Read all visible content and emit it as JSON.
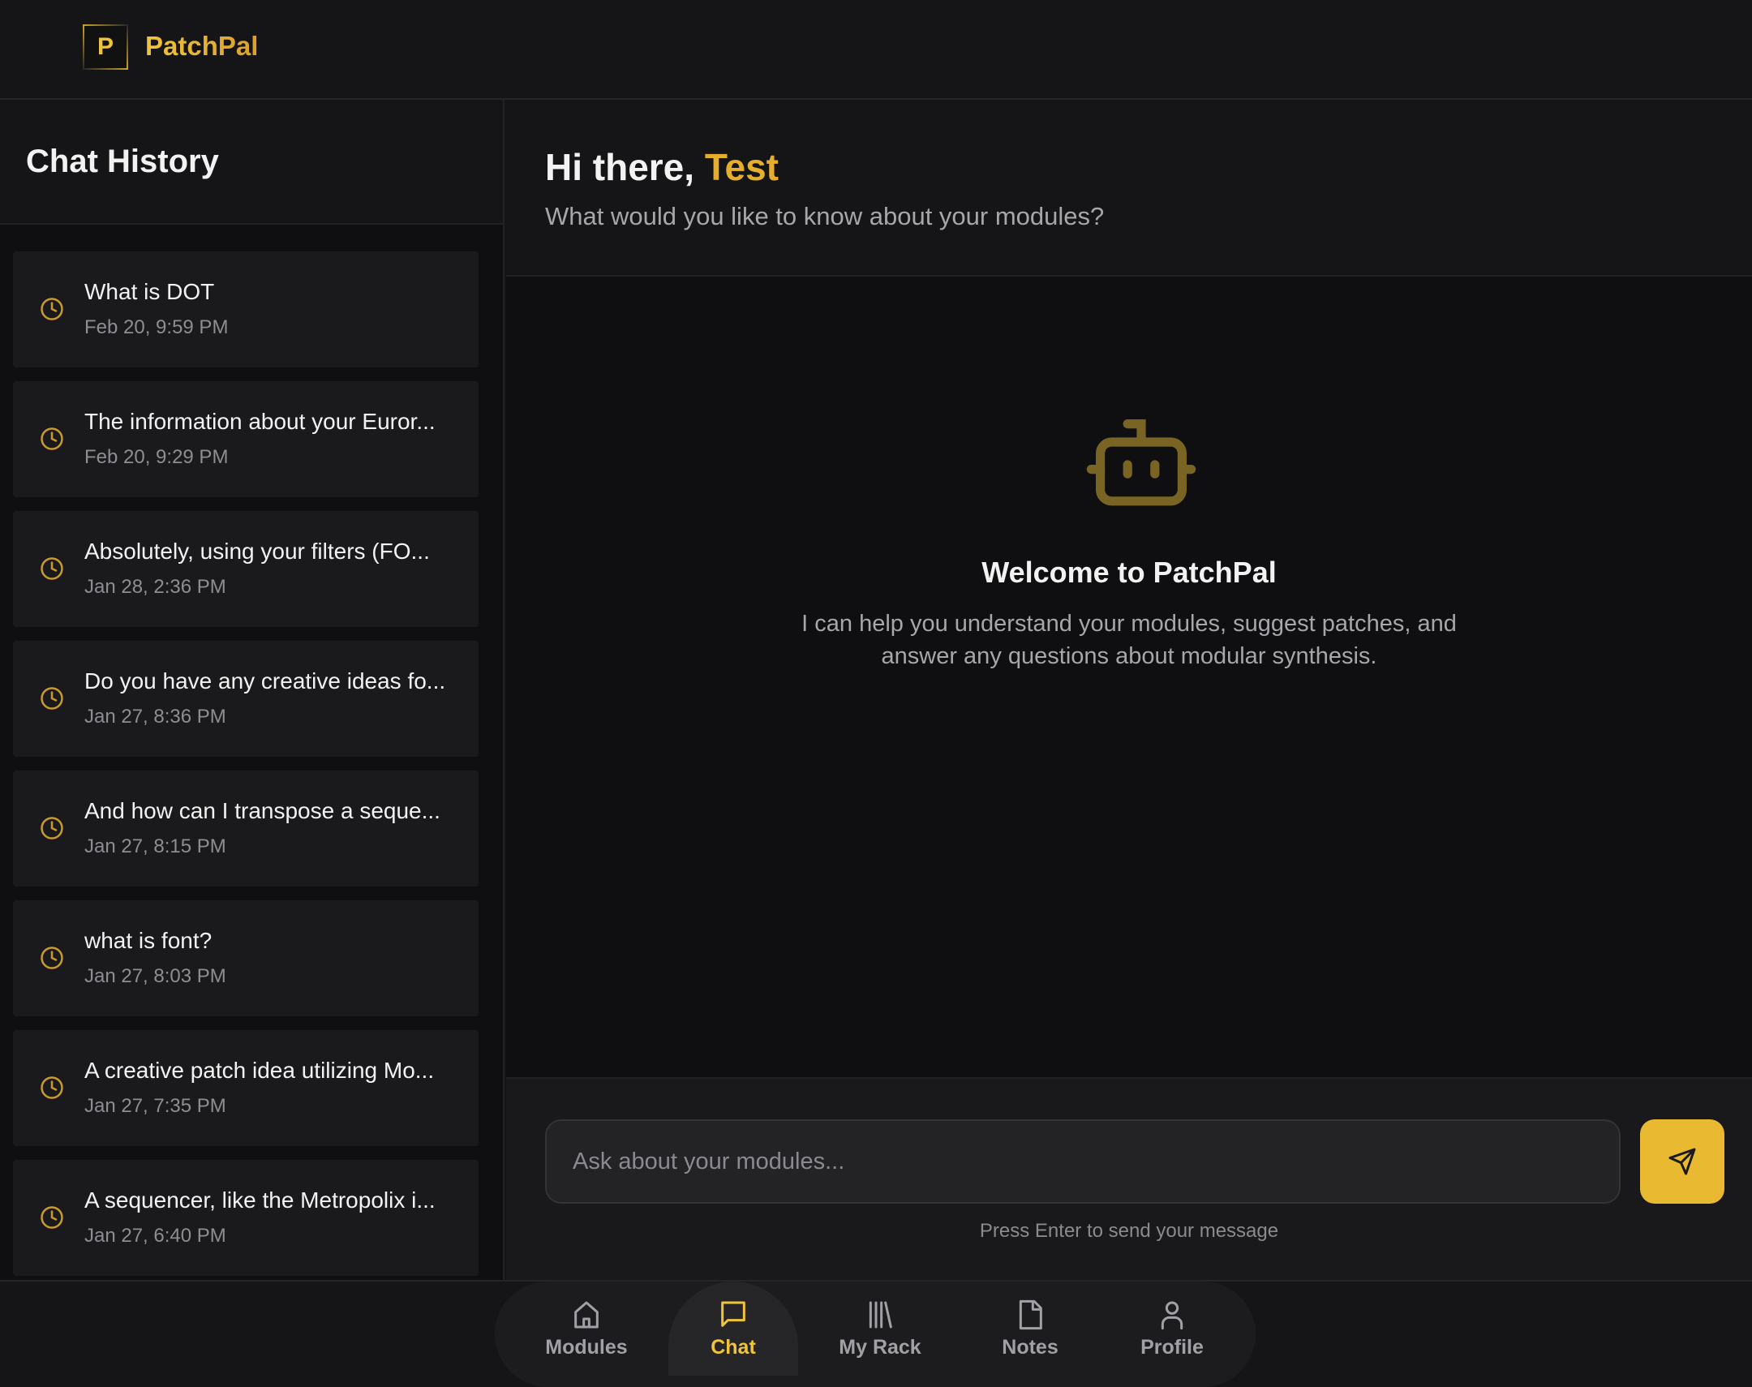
{
  "app": {
    "logo_letter": "P",
    "name": "PatchPal"
  },
  "sidebar": {
    "title": "Chat History",
    "items": [
      {
        "title": "What is DOT",
        "date": "Feb 20, 9:59 PM"
      },
      {
        "title": "The information about your Euror...",
        "date": "Feb 20, 9:29 PM"
      },
      {
        "title": "Absolutely, using your filters (FO...",
        "date": "Jan 28, 2:36 PM"
      },
      {
        "title": "Do you have any creative ideas fo...",
        "date": "Jan 27, 8:36 PM"
      },
      {
        "title": "And how can I transpose a seque...",
        "date": "Jan 27, 8:15 PM"
      },
      {
        "title": "what is font?",
        "date": "Jan 27, 8:03 PM"
      },
      {
        "title": "A creative patch idea utilizing Mo...",
        "date": "Jan 27, 7:35 PM"
      },
      {
        "title": "A sequencer, like the Metropolix i...",
        "date": "Jan 27, 6:40 PM"
      }
    ]
  },
  "main": {
    "greeting": "Hi there, ",
    "user": "Test",
    "subtitle": "What would you like to know about your modules?",
    "welcome_title": "Welcome to PatchPal",
    "welcome_line1": "I can help you understand your modules, suggest patches, and",
    "welcome_line2": "answer any questions about modular synthesis."
  },
  "composer": {
    "placeholder": "Ask about your modules...",
    "hint": "Press Enter to send your message"
  },
  "nav": [
    {
      "label": "Modules",
      "icon": "home-icon"
    },
    {
      "label": "Chat",
      "icon": "chat-icon",
      "active": true
    },
    {
      "label": "My Rack",
      "icon": "library-icon"
    },
    {
      "label": "Notes",
      "icon": "note-icon"
    },
    {
      "label": "Profile",
      "icon": "user-icon"
    }
  ],
  "colors": {
    "accent": "#e8b931",
    "background": "#151517"
  }
}
